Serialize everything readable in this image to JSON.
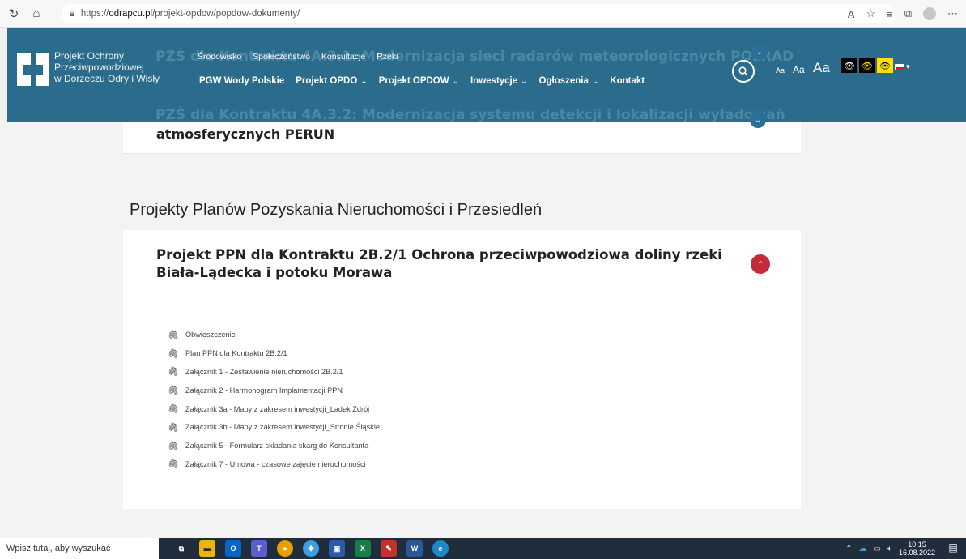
{
  "browser": {
    "url_prefix": "https://",
    "url_host": "odrapcu.pl",
    "url_path": "/projekt-opdow/popdow-dokumenty/"
  },
  "header": {
    "logo_lines": [
      "Projekt Ochrony",
      "Przeciwpowodziowej",
      "w Dorzeczu Odry i Wisły"
    ],
    "ghost_text_1": "PZŚ dla Kontraktu 4A.3.1: Modernizacja sieci radarów meteorologicznych POLRAD",
    "ghost_text_2": "PZŚ dla Kontraktu 4A.3.2: Modernizacja systemu detekcji i lokalizacji wyładowań",
    "top_links": [
      "Środowisko",
      "Społeczeństwo",
      "Konsultacje",
      "Rzeki"
    ],
    "main_nav": [
      {
        "label": "PGW Wody Polskie",
        "dropdown": false
      },
      {
        "label": "Projekt OPDO",
        "dropdown": true
      },
      {
        "label": "Projekt OPDOW",
        "dropdown": true
      },
      {
        "label": "Inwestycje",
        "dropdown": true
      },
      {
        "label": "Ogłoszenia",
        "dropdown": true
      },
      {
        "label": "Kontakt",
        "dropdown": false
      }
    ],
    "font_sizes": [
      "Aa",
      "Aa",
      "Aa"
    ]
  },
  "content": {
    "top_card_title": "atmosferycznych PERUN",
    "section_title": "Projekty Planów Pozyskania Nieruchomości i Przesiedleń",
    "project_title": "Projekt PPN dla Kontraktu 2B.2/1 Ochrona przeciwpowodziowa doliny rzeki Biała-Lądecka i potoku Morawa",
    "documents": [
      "Obwieszczenie",
      "Plan PPN dla Kontraktu 2B.2/1",
      "Załącznik 1 - Zestawienie nieruchomości 2B.2/1",
      "Załącznik 2 - Harmonogram Implamentacji PPN",
      "Załącznik 3a - Mapy z zakresem inwestycji_Ladek Zdrój",
      "Załącznik 3b - Mapy z zakresem inwestycji_Stronie Śląskie",
      "Załącznik 5 - Formularz składania skarg do Konsultanta",
      "Załącznik 7 - Umowa - czasowe zajęcie nieruchomości"
    ]
  },
  "taskbar": {
    "search_placeholder": "Wpisz tutaj, aby wyszukać",
    "time": "10:15",
    "date": "16.08.2022"
  },
  "colors": {
    "header_bg": "#2b6c8c",
    "accent_red": "#c32a3a",
    "page_bg": "#f3f3f3"
  }
}
